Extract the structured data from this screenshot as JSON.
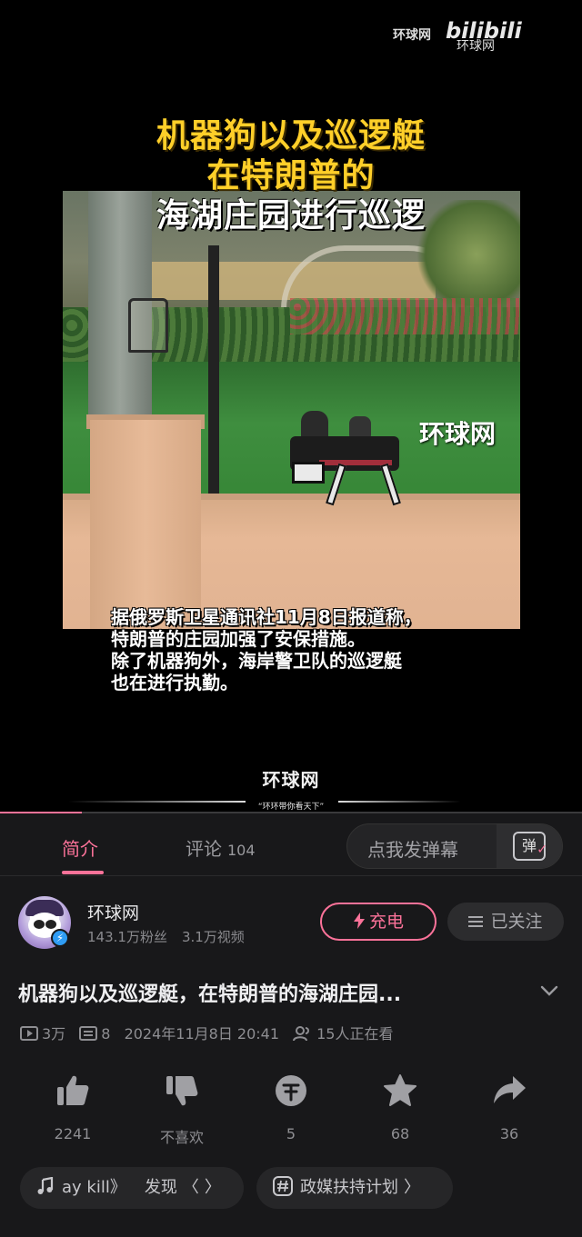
{
  "video": {
    "top_watermark": "环球网",
    "bili_logo": "bilibili",
    "bili_sub": "环球网",
    "title_lines": [
      "机器狗以及巡逻艇",
      "在特朗普的",
      "海湖庄园进行巡逻"
    ],
    "scene_watermark": "环球网",
    "subtitle_lines": [
      "据俄罗斯卫星通讯社11月8日报道称，",
      "特朗普的庄园加强了安保措施。",
      "除了机器狗外，海岸警卫队的巡逻艇",
      "也在进行执勤。"
    ],
    "bottom_watermark": "环球网",
    "bottom_slogan": "“环环带你看天下”",
    "progress": 0.14
  },
  "tabs": {
    "intro": "简介",
    "comments": "评论",
    "comments_count": "104",
    "danmu_placeholder": "点我发弹幕",
    "danmu_icon": "弹"
  },
  "uploader": {
    "name": "环球网",
    "fans": "143.1万粉丝",
    "videos": "3.1万视频",
    "charge_label": "充电",
    "follow_label": "已关注"
  },
  "details": {
    "title": "机器狗以及巡逻艇，在特朗普的海湖庄园...",
    "plays": "3万",
    "danmaku": "8",
    "date": "2024年11月8日 20:41",
    "watching": "15人正在看"
  },
  "actions": {
    "like": "2241",
    "dislike": "不喜欢",
    "coin": "5",
    "favorite": "68",
    "share": "36"
  },
  "chips": {
    "music": "ay kill》",
    "discover": "发现",
    "topic": "政媒扶持计划"
  },
  "colors": {
    "accent": "#fb7299",
    "title_yellow": "#ffcf29",
    "background": "#18181a"
  }
}
